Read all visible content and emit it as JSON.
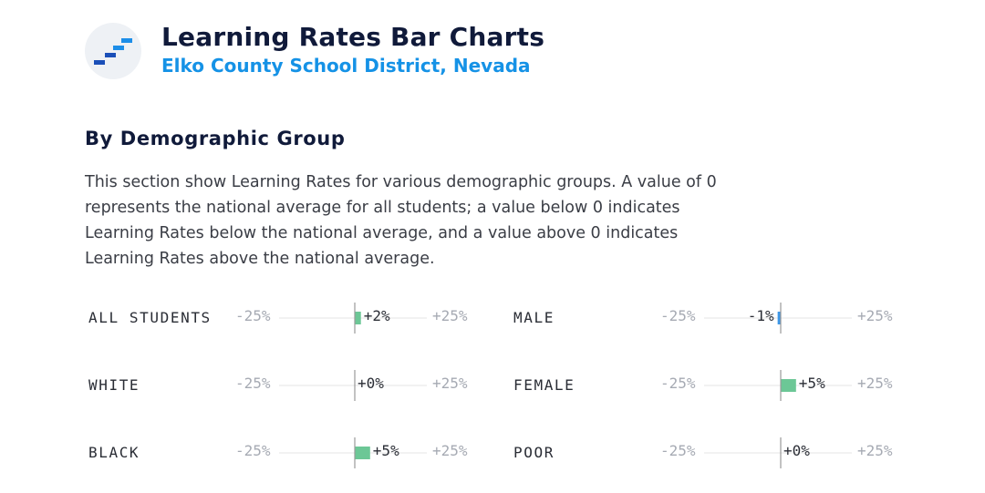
{
  "header": {
    "title": "Learning Rates Bar Charts",
    "subtitle": "Elko County School District, Nevada"
  },
  "logo_icon": "staircase-bars-icon",
  "section": {
    "title": "By Demographic Group",
    "description": "This section show Learning Rates for various demographic groups. A value of 0 represents the national average for all students; a value below 0 indicates Learning Rates below the national average, and a value above 0 indicates Learning Rates above the national average."
  },
  "colors": {
    "positive": "#6cc796",
    "negative": "#3d97e8",
    "axis": "#999999",
    "track": "#eeeeee",
    "title": "#101a3a",
    "subtitle": "#1592e6"
  },
  "chart_data": {
    "type": "bar",
    "orientation": "horizontal",
    "xlim": [
      -25,
      25
    ],
    "tick_labels": [
      "-25%",
      "+25%"
    ],
    "groups": [
      {
        "label": "ALL STUDENTS",
        "value": 2,
        "display": "+2%"
      },
      {
        "label": "MALE",
        "value": -1,
        "display": "-1%"
      },
      {
        "label": "WHITE",
        "value": 0,
        "display": "+0%"
      },
      {
        "label": "FEMALE",
        "value": 5,
        "display": "+5%"
      },
      {
        "label": "BLACK",
        "value": 5,
        "display": "+5%"
      },
      {
        "label": "POOR",
        "value": 0,
        "display": "+0%"
      }
    ]
  }
}
